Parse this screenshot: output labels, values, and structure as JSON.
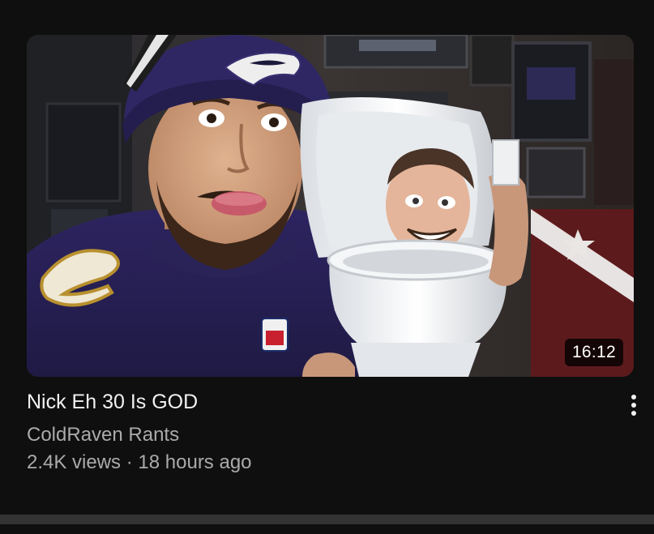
{
  "video": {
    "duration": "16:12",
    "title": "Nick Eh 30 Is GOD",
    "channel": "ColdRaven Rants",
    "views": "2.4K views",
    "separator": "·",
    "age": "18 hours ago"
  },
  "icons": {
    "menu": "more-vertical-icon"
  },
  "colors": {
    "background": "#0f0f0f",
    "title_text": "#f1f1f1",
    "secondary_text": "#aaaaaa",
    "duration_badge": "#000000"
  }
}
